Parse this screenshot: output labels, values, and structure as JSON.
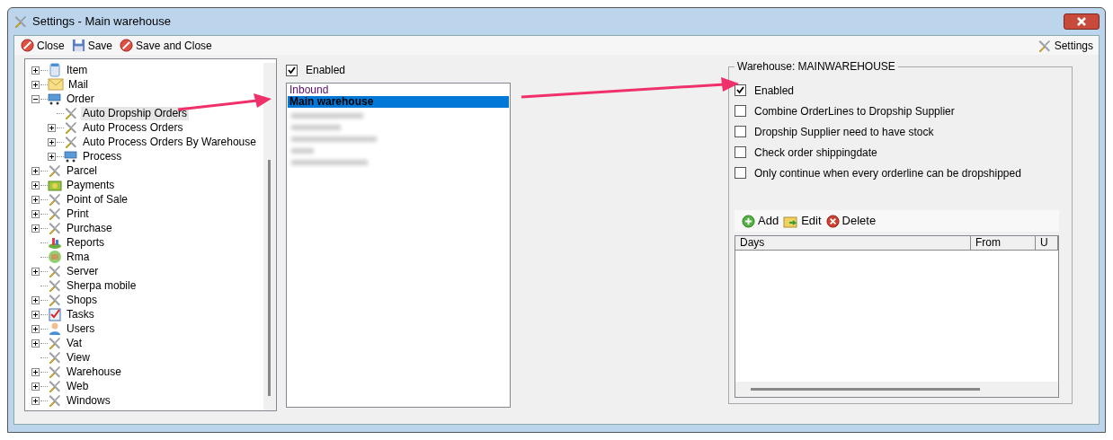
{
  "window": {
    "title": "Settings - Main warehouse"
  },
  "toolbar": {
    "buttons": [
      {
        "label": "Close",
        "kind": "close"
      },
      {
        "label": "Save",
        "kind": "save"
      },
      {
        "label": "Save and Close",
        "kind": "close"
      }
    ],
    "settings_button": "Settings"
  },
  "tree": {
    "items": [
      {
        "label": "Item",
        "kind": "item",
        "expanded": false,
        "selected": false
      },
      {
        "label": "Mail",
        "kind": "mail",
        "expanded": false,
        "selected": false
      },
      {
        "label": "Order",
        "kind": "cart",
        "expanded": true,
        "selected": false,
        "children": [
          {
            "label": "Auto Dropship Orders",
            "kind": "tools",
            "selected": true
          },
          {
            "label": "Auto Process Orders",
            "kind": "tools",
            "expanded": false,
            "selected": false
          },
          {
            "label": "Auto Process Orders By Warehouse",
            "kind": "tools",
            "expanded": false,
            "selected": false
          },
          {
            "label": "Process",
            "kind": "cart",
            "expanded": false,
            "selected": false
          }
        ]
      },
      {
        "label": "Parcel",
        "kind": "tools",
        "expanded": false,
        "selected": false
      },
      {
        "label": "Payments",
        "kind": "payments",
        "expanded": false,
        "selected": false
      },
      {
        "label": "Point of Sale",
        "kind": "tools",
        "expanded": false,
        "selected": false
      },
      {
        "label": "Print",
        "kind": "tools",
        "expanded": false,
        "selected": false
      },
      {
        "label": "Purchase",
        "kind": "tools",
        "expanded": false,
        "selected": false
      },
      {
        "label": "Reports",
        "kind": "reports",
        "selected": false
      },
      {
        "label": "Rma",
        "kind": "rma",
        "selected": false
      },
      {
        "label": "Server",
        "kind": "tools",
        "expanded": false,
        "selected": false
      },
      {
        "label": "Sherpa mobile",
        "kind": "tools",
        "selected": false
      },
      {
        "label": "Shops",
        "kind": "tools",
        "expanded": false,
        "selected": false
      },
      {
        "label": "Tasks",
        "kind": "tasks",
        "expanded": false,
        "selected": false
      },
      {
        "label": "Users",
        "kind": "users",
        "expanded": false,
        "selected": false
      },
      {
        "label": "Vat",
        "kind": "tools",
        "expanded": false,
        "selected": false
      },
      {
        "label": "View",
        "kind": "tools",
        "selected": false
      },
      {
        "label": "Warehouse",
        "kind": "tools",
        "expanded": false,
        "selected": false
      },
      {
        "label": "Web",
        "kind": "tools",
        "expanded": false,
        "selected": false
      },
      {
        "label": "Windows",
        "kind": "tools",
        "expanded": false,
        "selected": false
      }
    ]
  },
  "warehouses": {
    "enabled": {
      "label": "Enabled",
      "checked": true
    },
    "items": [
      {
        "label": "Inbound",
        "selected": false
      },
      {
        "label": "Main warehouse",
        "selected": true
      }
    ]
  },
  "warehouse_group": {
    "title": "Warehouse: MAINWAREHOUSE",
    "options": [
      {
        "label": "Enabled",
        "checked": true
      },
      {
        "label": "Combine OrderLines to Dropship Supplier",
        "checked": false
      },
      {
        "label": "Dropship Supplier need to have stock",
        "checked": false
      },
      {
        "label": "Check order shippingdate",
        "checked": false
      },
      {
        "label": "Only continue when every orderline can be dropshipped",
        "checked": false
      }
    ],
    "toolbar": [
      {
        "label": "Add",
        "kind": "add"
      },
      {
        "label": "Edit",
        "kind": "edit"
      },
      {
        "label": "Delete",
        "kind": "delete"
      }
    ],
    "table": {
      "columns": [
        "Days",
        "From",
        "U"
      ]
    }
  }
}
